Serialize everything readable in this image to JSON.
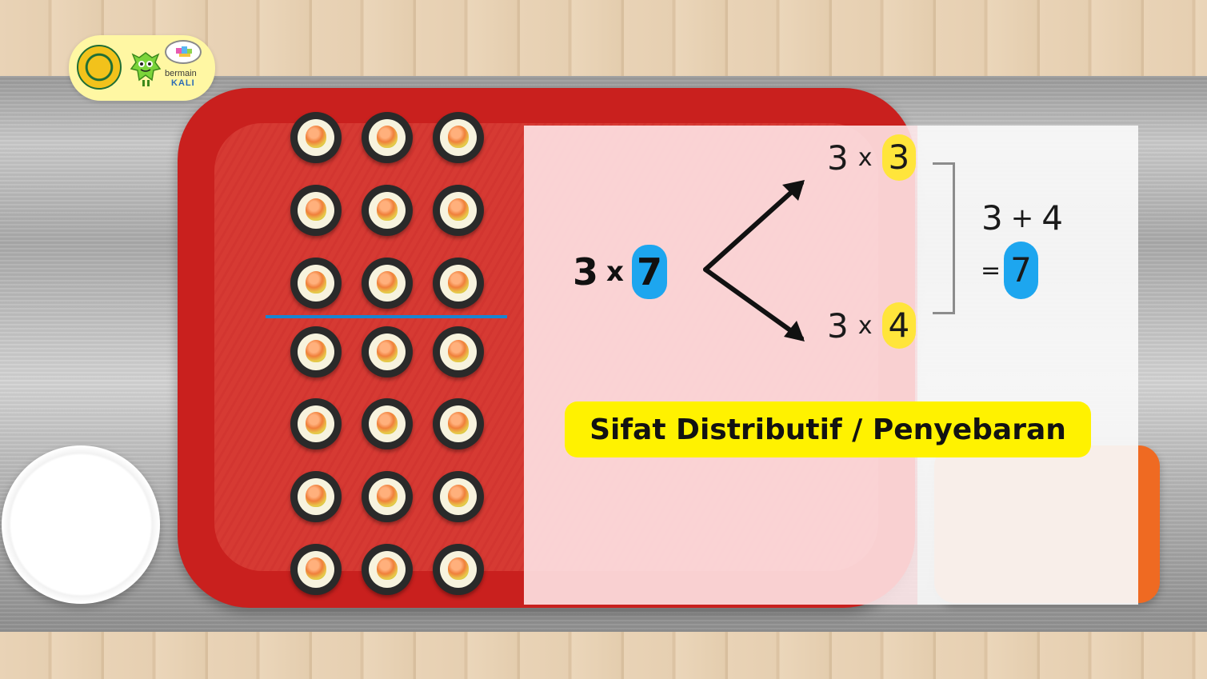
{
  "logo": {
    "text_line1": "bermain",
    "text_line2": "KALI"
  },
  "sushi_grid": {
    "rows": 7,
    "cols": 3,
    "divider_after_row": 3
  },
  "math": {
    "main_left": "3",
    "main_op": "x",
    "main_right": "7",
    "top_left": "3",
    "top_op": "x",
    "top_right": "3",
    "bottom_left": "3",
    "bottom_op": "x",
    "bottom_right": "4",
    "sum_left": "3",
    "sum_op": "+",
    "sum_right": "4",
    "equals": "=",
    "result": "7"
  },
  "title": "Sifat Distributif / Penyebaran",
  "colors": {
    "blue_highlight": "#1da6ef",
    "yellow_highlight": "#ffe53b",
    "title_badge": "#fff200",
    "tray_red": "#c9201e",
    "divider_blue": "#1a84d1"
  }
}
